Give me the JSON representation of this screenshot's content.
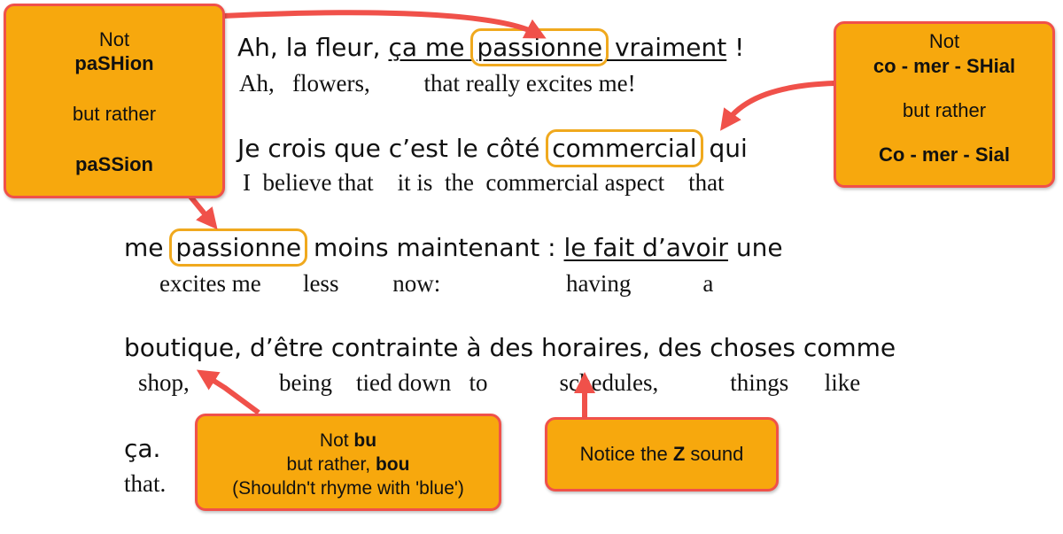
{
  "lines": [
    {
      "french": {
        "pre": "Ah, la fleur, ",
        "underlined_pre": "ça me ",
        "highlight": "passionne",
        "underlined_post": " vraiment",
        "post": " !"
      },
      "english": "Ah,   flowers,         that really excites me!"
    },
    {
      "french": {
        "pre": "Je crois que c’est le côté ",
        "highlight": "commercial",
        "post": " qui"
      },
      "english": "I  believe that    it is  the  commercial aspect    that"
    },
    {
      "french": {
        "pre": "me ",
        "highlight": "passionne",
        "mid": " moins maintenant : ",
        "underlined": "le fait d’avoir",
        "post": " une"
      },
      "english": "excites me       less         now:                     having            a"
    },
    {
      "french": {
        "text": "boutique, d’être contrainte à des horaires, des choses comme"
      },
      "english": "shop,               being    tied down   to            schedules,            things      like"
    },
    {
      "french": {
        "text": "ça."
      },
      "english": "that."
    }
  ],
  "notes": {
    "passion": {
      "line1": "Not",
      "line2": "paSHion",
      "line3": "but rather",
      "line4": "paSSion"
    },
    "commercial": {
      "line1": "Not",
      "line2": "co - mer - SHial",
      "line3": "but rather",
      "line4": "Co  - mer - Sial"
    },
    "boutique": {
      "line1_plain": "Not ",
      "line1_bold": "bu",
      "line2_plain": "but rather, ",
      "line2_bold": "bou",
      "line3": "(Shouldn't rhyme with 'blue')"
    },
    "z_sound": {
      "plain_pre": "Notice the ",
      "bold": "Z",
      "plain_post": " sound"
    }
  },
  "colors": {
    "note_fill": "#f7a80d",
    "note_border": "#f0514a",
    "highlight_border": "#f0a91e",
    "arrow": "#f0514a"
  }
}
